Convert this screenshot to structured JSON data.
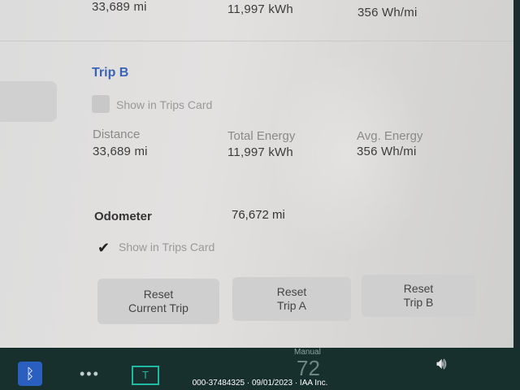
{
  "trip_a_top": {
    "distance_value": "33,689  mi",
    "energy_value": "11,997  kWh",
    "avg_energy_value": "356  Wh/mi"
  },
  "trip_b": {
    "title": "Trip B",
    "show_in_trips_card_label": "Show in Trips Card",
    "show_in_trips_card_checked": false,
    "distance_label": "Distance",
    "distance_value": "33,689  mi",
    "energy_label": "Total Energy",
    "energy_value": "11,997  kWh",
    "avg_energy_label": "Avg. Energy",
    "avg_energy_value": "356  Wh/mi"
  },
  "odometer": {
    "label": "Odometer",
    "value": "76,672  mi",
    "show_in_trips_card_label": "Show in Trips Card",
    "show_in_trips_card_checked": true
  },
  "buttons": {
    "reset_current_trip": "Reset\nCurrent Trip",
    "reset_trip_a": "Reset\nTrip A",
    "reset_trip_b": "Reset\nTrip B"
  },
  "taskbar": {
    "bluetooth_icon": "bluetooth-icon",
    "more_icon": "more-dots-icon",
    "toybox_icon": "t-app-icon",
    "manual_label": "Manual",
    "speed_value": "72",
    "volume_icon": "volume-icon"
  },
  "watermark": "000-37484325 · 09/01/2023 · IAA Inc.",
  "colors": {
    "accent": "#3b63b5",
    "screen_bg": "#dcdcdc",
    "taskbar_bg": "#17302e"
  }
}
